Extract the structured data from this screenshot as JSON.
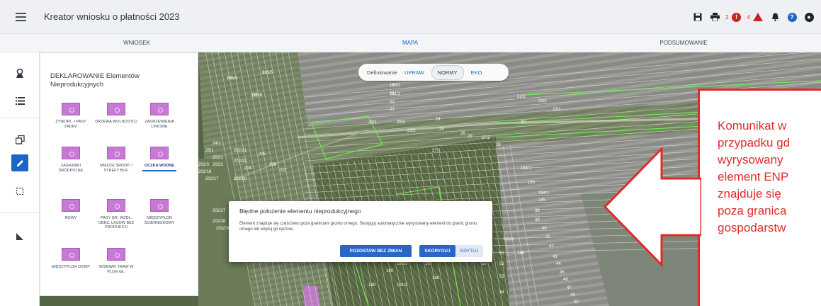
{
  "header": {
    "title": "Kreator wniosku o płatności 2023",
    "error_count": "2",
    "warning_count": "4"
  },
  "tabs": [
    {
      "label": "WNIOSEK",
      "active": false
    },
    {
      "label": "MAPA",
      "active": true
    },
    {
      "label": "PODSUMOWANIE",
      "active": false
    }
  ],
  "panel": {
    "title": "DEKLAROWANIE Elementów Nieprodukcyjnych",
    "tiles": [
      {
        "label": "ŻYWOPŁ. / PASY ZADRZ"
      },
      {
        "label": "DRZEWA WOLNOSTOJ"
      },
      {
        "label": "ZADRZEWIENIA LINIOWE"
      },
      {
        "label": "ZAGAJNIKI ŚRÓDPOLNE"
      },
      {
        "label": "MIEDZE ŚRÓDP. I STREFY BUF."
      },
      {
        "label": "OCZKA WODNE",
        "selected": true
      },
      {
        "label": "ROWY"
      },
      {
        "label": "PASY GR. WZDŁ. OBRZ. LASÓW BEZ PRODUKCJI"
      },
      {
        "label": "MIĘDZYPLON ŚCIERNISKOWY"
      },
      {
        "label": "MIĘDZYPLON OZIMY"
      },
      {
        "label": "WSIEWKI TRAW W PLON GŁ."
      }
    ]
  },
  "map_toggle": {
    "label": "Definiowanie",
    "options": [
      "UPRAW",
      "NORMY",
      "EKO"
    ],
    "active": "NORMY"
  },
  "parcel_labels": [
    "2/2",
    "3",
    "2/1",
    "19",
    "21",
    "22",
    "23",
    "20/1",
    "20/2",
    "21/2",
    "24",
    "25",
    "26",
    "27/1",
    "27/2",
    "28",
    "29",
    "30",
    "31/1",
    "31/2",
    "23/1",
    "24/1",
    "25/1",
    "202/1",
    "202/2",
    "202/3",
    "202/16",
    "202/17",
    "202/27",
    "202/28",
    "202/29",
    "202/30",
    "202/31",
    "202/32",
    "204",
    "205",
    "206",
    "207",
    "185/1",
    "186",
    "187",
    "188",
    "189",
    "190",
    "191/2",
    "192/3",
    "193",
    "194/1",
    "245",
    "38",
    "39",
    "40",
    "41",
    "42",
    "43",
    "44",
    "45",
    "46",
    "47",
    "49",
    "50",
    "51",
    "52",
    "53",
    "54",
    "55",
    "185/3",
    "185/4",
    "185/5",
    "185/6",
    "153/1",
    "191/1"
  ],
  "modal": {
    "title": "Błędne położenie elementu nieprodukcyjnego",
    "text": "Element znajduje się częściowo poza granicami gruntu ornego. Skoryguj automatycznie wyrysowany element do granic gruntu ornego lub edytuj go ręcznie.",
    "btn_keep": "POZOSTAW BEZ ZMIAN",
    "btn_fix": "SKORYGUJ",
    "btn_edit": "EDYTUJ"
  },
  "callout": {
    "text": "Komunikat w\nprzypadku gd\nwyrysowany\nelement ENP\nznajduje się\npoza granica\ngospodarstw"
  },
  "colors": {
    "accent": "#1e64c8",
    "callout_red": "#e02b2b",
    "tile_purple": "#c879d6"
  }
}
